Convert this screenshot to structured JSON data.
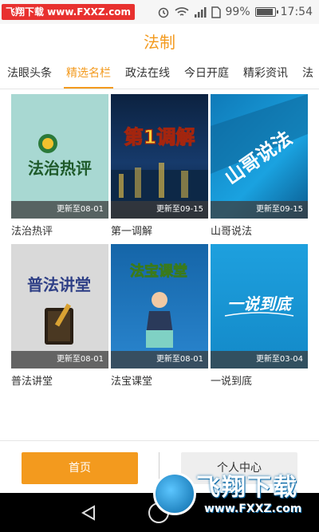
{
  "status_bar": {
    "watermark": "飞翔下载 www.FXXZ.com",
    "battery": "99%",
    "time": "17:54"
  },
  "header": {
    "title": "法制"
  },
  "tabs": [
    {
      "label": "法眼头条"
    },
    {
      "label": "精选名栏"
    },
    {
      "label": "政法在线"
    },
    {
      "label": "今日开庭"
    },
    {
      "label": "精彩资讯"
    },
    {
      "label": "法"
    }
  ],
  "active_tab": "精选名栏",
  "programs": [
    {
      "title": "法治热评",
      "update": "更新至08-01",
      "logo": "法治热评"
    },
    {
      "title": "第一调解",
      "update": "更新至09-15",
      "logo": "第1调解"
    },
    {
      "title": "山哥说法",
      "update": "更新至09-15",
      "logo": "山哥说法"
    },
    {
      "title": "普法讲堂",
      "update": "更新至08-01",
      "logo": "普法讲堂"
    },
    {
      "title": "法宝课堂",
      "update": "更新至08-01",
      "logo": "法宝课堂"
    },
    {
      "title": "一说到底",
      "update": "更新至03-04",
      "logo": "一说到底"
    }
  ],
  "bottom_nav": {
    "home_label": "首页",
    "profile_label": "个人中心"
  },
  "watermark_logo": {
    "name": "飞翔下载",
    "url": "www.FXXZ.com"
  },
  "colors": {
    "accent": "#f39a1e"
  }
}
